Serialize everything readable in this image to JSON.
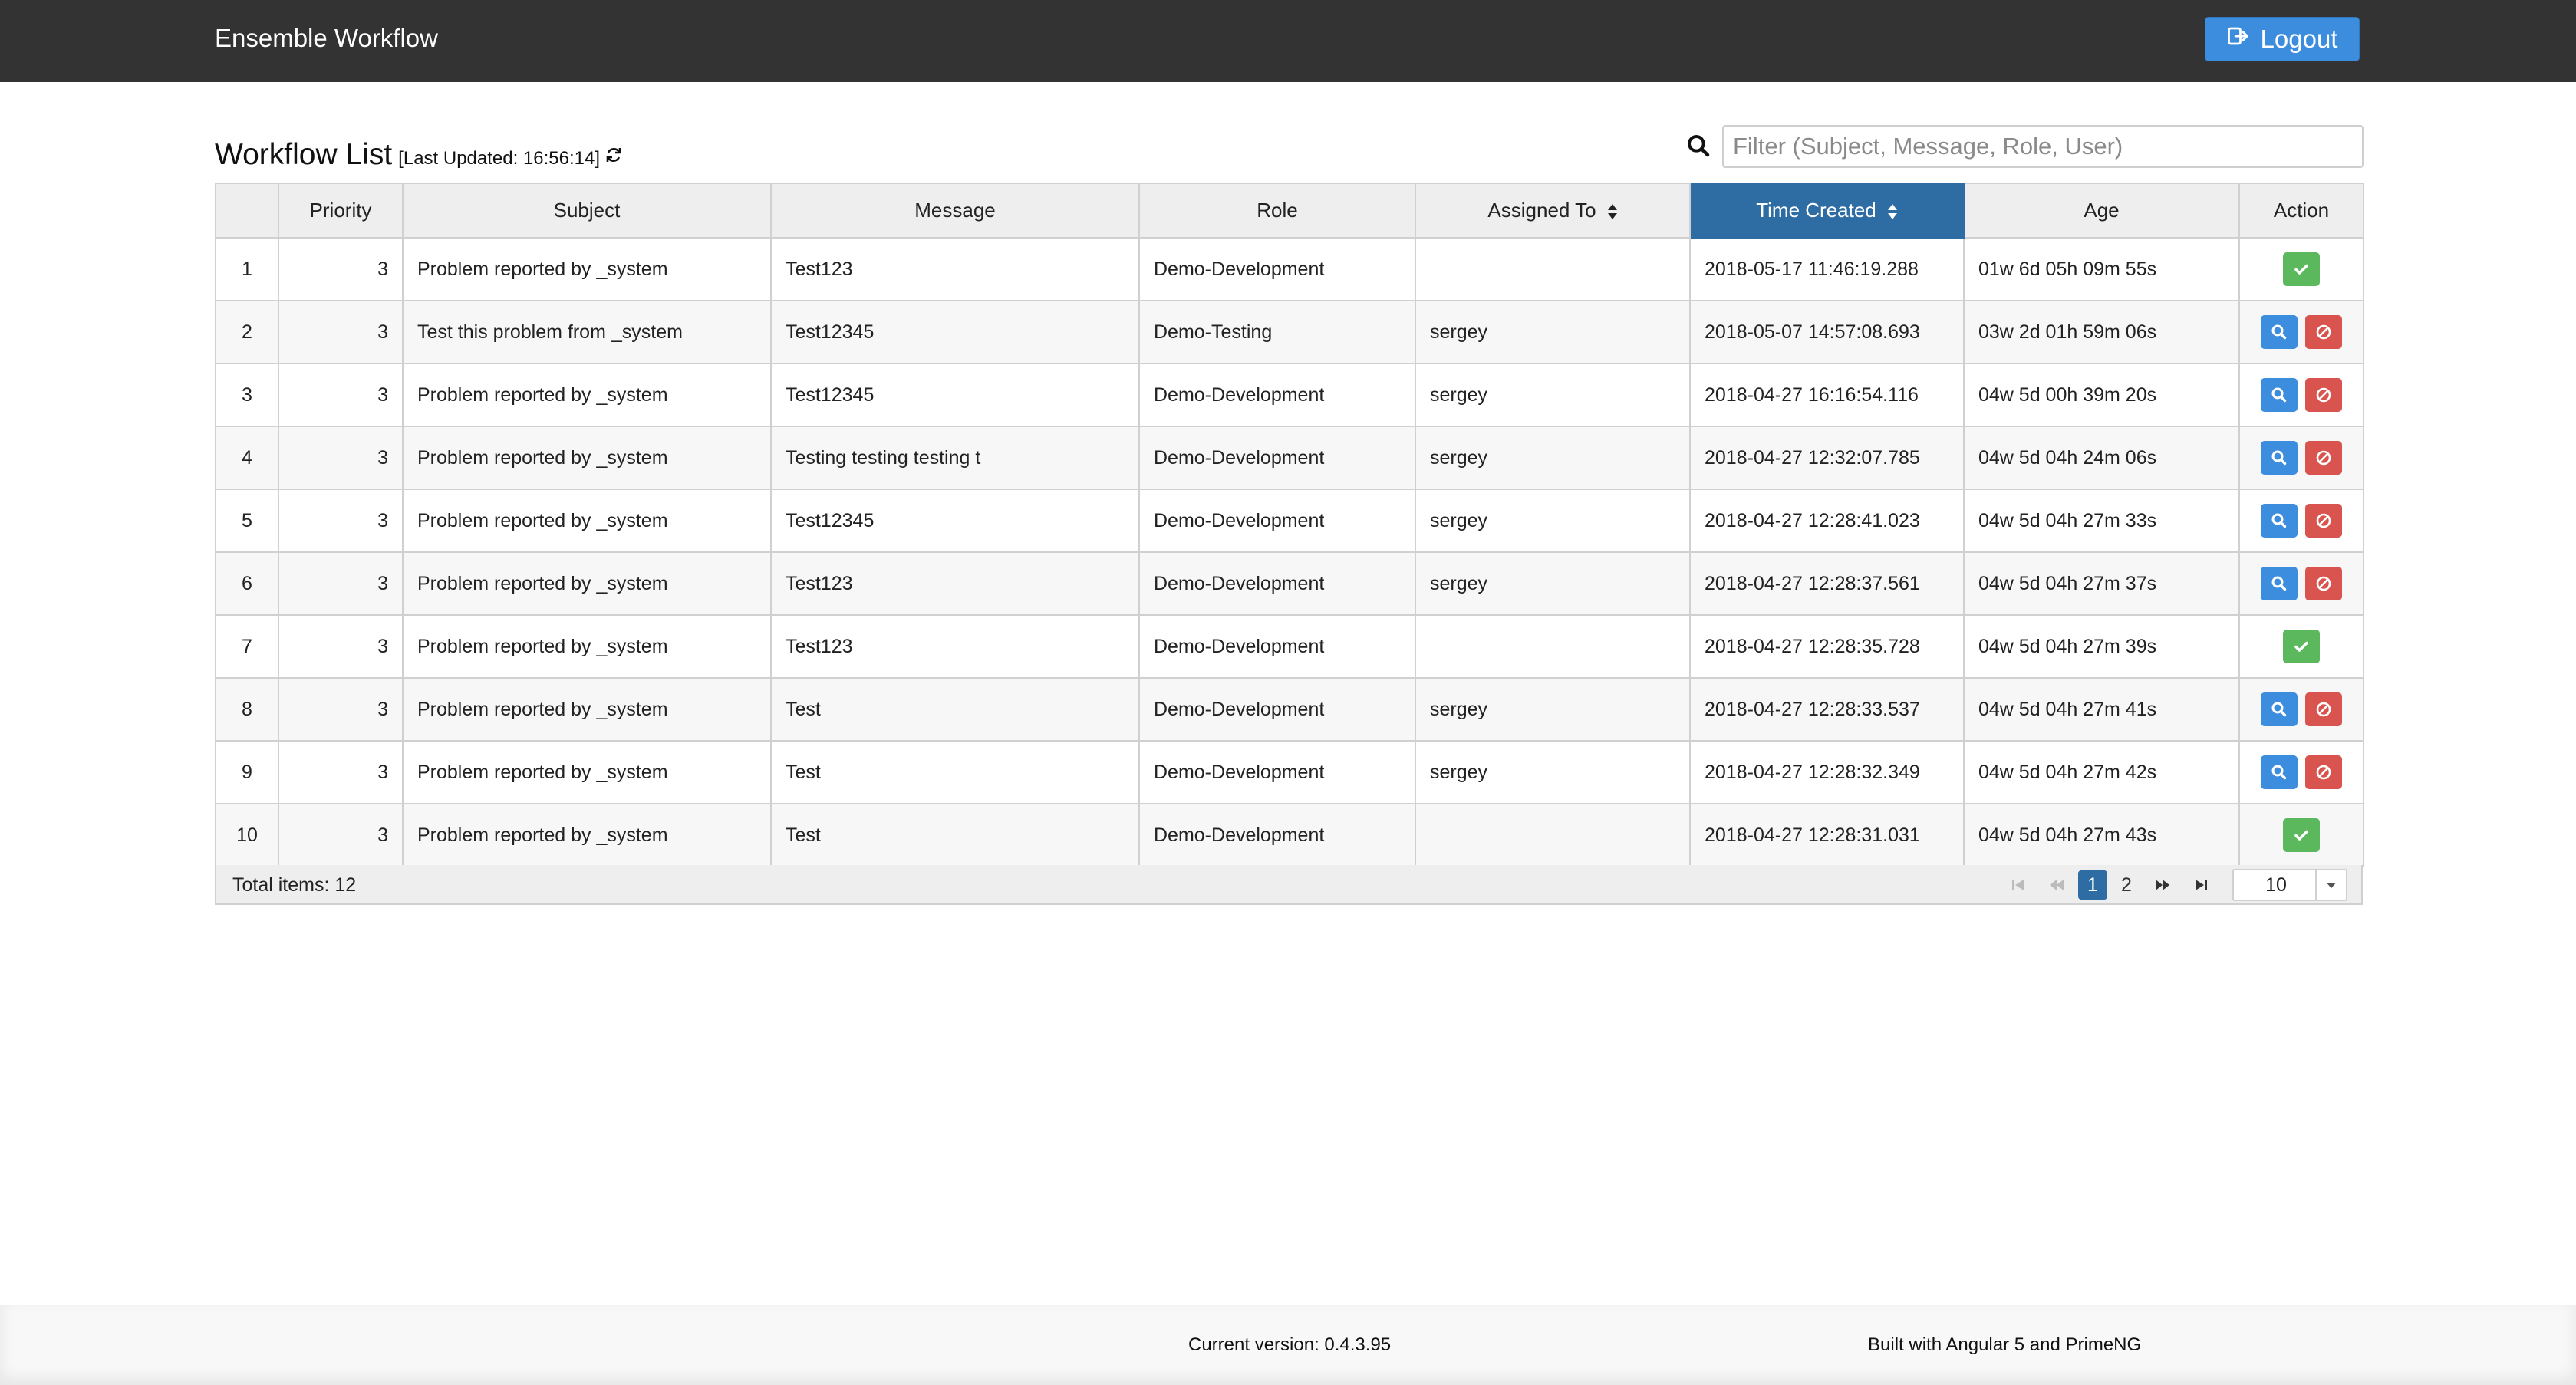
{
  "header": {
    "brand": "Ensemble Workflow",
    "logout_label": "Logout"
  },
  "list": {
    "title": "Workflow List",
    "last_updated": "[Last Updated: 16:56:14]",
    "filter_placeholder": "Filter (Subject, Message, Role, User)",
    "filter_value": ""
  },
  "table": {
    "columns": [
      "",
      "Priority",
      "Subject",
      "Message",
      "Role",
      "Assigned To",
      "Time Created",
      "Age",
      "Action"
    ],
    "sorted_column": "Time Created",
    "rows": [
      {
        "num": "1",
        "priority": "3",
        "subject": "Problem reported by _system",
        "message": "Test123",
        "role": "Demo-Development",
        "assigned": "",
        "created": "2018-05-17 11:46:19.288",
        "age": "01w 6d 05h 09m 55s",
        "actions": [
          "check-icon"
        ]
      },
      {
        "num": "2",
        "priority": "3",
        "subject": "Test this problem from _system",
        "message": "Test12345",
        "role": "Demo-Testing",
        "assigned": "sergey",
        "created": "2018-05-07 14:57:08.693",
        "age": "03w 2d 01h 59m 06s",
        "actions": [
          "search-icon",
          "ban-icon"
        ]
      },
      {
        "num": "3",
        "priority": "3",
        "subject": "Problem reported by _system",
        "message": "Test12345",
        "role": "Demo-Development",
        "assigned": "sergey",
        "created": "2018-04-27 16:16:54.116",
        "age": "04w 5d 00h 39m 20s",
        "actions": [
          "search-icon",
          "ban-icon"
        ]
      },
      {
        "num": "4",
        "priority": "3",
        "subject": "Problem reported by _system",
        "message": "Testing testing testing t",
        "role": "Demo-Development",
        "assigned": "sergey",
        "created": "2018-04-27 12:32:07.785",
        "age": "04w 5d 04h 24m 06s",
        "actions": [
          "search-icon",
          "ban-icon"
        ]
      },
      {
        "num": "5",
        "priority": "3",
        "subject": "Problem reported by _system",
        "message": "Test12345",
        "role": "Demo-Development",
        "assigned": "sergey",
        "created": "2018-04-27 12:28:41.023",
        "age": "04w 5d 04h 27m 33s",
        "actions": [
          "search-icon",
          "ban-icon"
        ]
      },
      {
        "num": "6",
        "priority": "3",
        "subject": "Problem reported by _system",
        "message": "Test123",
        "role": "Demo-Development",
        "assigned": "sergey",
        "created": "2018-04-27 12:28:37.561",
        "age": "04w 5d 04h 27m 37s",
        "actions": [
          "search-icon",
          "ban-icon"
        ]
      },
      {
        "num": "7",
        "priority": "3",
        "subject": "Problem reported by _system",
        "message": "Test123",
        "role": "Demo-Development",
        "assigned": "",
        "created": "2018-04-27 12:28:35.728",
        "age": "04w 5d 04h 27m 39s",
        "actions": [
          "check-icon"
        ]
      },
      {
        "num": "8",
        "priority": "3",
        "subject": "Problem reported by _system",
        "message": "Test",
        "role": "Demo-Development",
        "assigned": "sergey",
        "created": "2018-04-27 12:28:33.537",
        "age": "04w 5d 04h 27m 41s",
        "actions": [
          "search-icon",
          "ban-icon"
        ]
      },
      {
        "num": "9",
        "priority": "3",
        "subject": "Problem reported by _system",
        "message": "Test",
        "role": "Demo-Development",
        "assigned": "sergey",
        "created": "2018-04-27 12:28:32.349",
        "age": "04w 5d 04h 27m 42s",
        "actions": [
          "search-icon",
          "ban-icon"
        ]
      },
      {
        "num": "10",
        "priority": "3",
        "subject": "Problem reported by _system",
        "message": "Test",
        "role": "Demo-Development",
        "assigned": "",
        "created": "2018-04-27 12:28:31.031",
        "age": "04w 5d 04h 27m 43s",
        "actions": [
          "check-icon"
        ]
      }
    ]
  },
  "pagination": {
    "total_items": "Total items: 12",
    "pages": [
      "1",
      "2"
    ],
    "current_page": "1",
    "rows_per_page": "10"
  },
  "footer": {
    "version": "Current version: 0.4.3.95",
    "built_with": "Built with Angular 5 and PrimeNG"
  },
  "colors": {
    "navbar": "#333333",
    "primary": "#3c8dde",
    "active_header": "#2e6da4",
    "success": "#5cb85c",
    "danger": "#d9534f"
  }
}
